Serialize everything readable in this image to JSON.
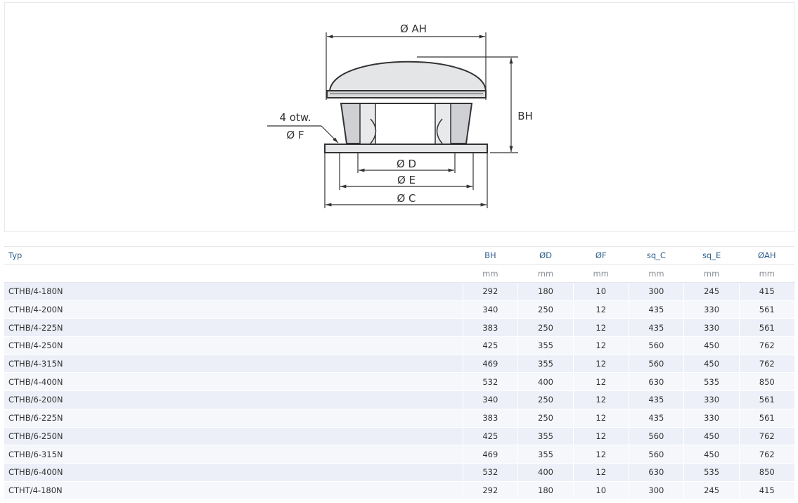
{
  "drawing": {
    "labels": {
      "diameter_ah": "Ø AH",
      "height_bh": "BH",
      "holes_count": "4 otw.",
      "hole_diameter": "Ø F",
      "diameter_d": "Ø D",
      "diameter_e": "Ø E",
      "diameter_c": "Ø C"
    }
  },
  "table": {
    "headers": [
      "Typ",
      "BH",
      "ØD",
      "ØF",
      "sq_C",
      "sq_E",
      "ØAH"
    ],
    "units": [
      "",
      "mm",
      "mm",
      "mm",
      "mm",
      "mm",
      "mm"
    ],
    "rows": [
      [
        "CTHB/4-180N",
        "292",
        "180",
        "10",
        "300",
        "245",
        "415"
      ],
      [
        "CTHB/4-200N",
        "340",
        "250",
        "12",
        "435",
        "330",
        "561"
      ],
      [
        "CTHB/4-225N",
        "383",
        "250",
        "12",
        "435",
        "330",
        "561"
      ],
      [
        "CTHB/4-250N",
        "425",
        "355",
        "12",
        "560",
        "450",
        "762"
      ],
      [
        "CTHB/4-315N",
        "469",
        "355",
        "12",
        "560",
        "450",
        "762"
      ],
      [
        "CTHB/4-400N",
        "532",
        "400",
        "12",
        "630",
        "535",
        "850"
      ],
      [
        "CTHB/6-200N",
        "340",
        "250",
        "12",
        "435",
        "330",
        "561"
      ],
      [
        "CTHB/6-225N",
        "383",
        "250",
        "12",
        "435",
        "330",
        "561"
      ],
      [
        "CTHB/6-250N",
        "425",
        "355",
        "12",
        "560",
        "450",
        "762"
      ],
      [
        "CTHB/6-315N",
        "469",
        "355",
        "12",
        "560",
        "450",
        "762"
      ],
      [
        "CTHB/6-400N",
        "532",
        "400",
        "12",
        "630",
        "535",
        "850"
      ],
      [
        "CTHT/4-180N",
        "292",
        "180",
        "10",
        "300",
        "245",
        "415"
      ]
    ]
  }
}
